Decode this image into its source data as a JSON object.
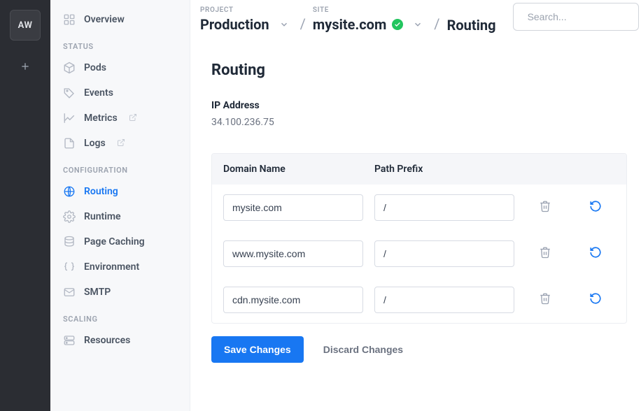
{
  "rail": {
    "workspace_initials": "AW"
  },
  "breadcrumb": {
    "project_label": "PROJECT",
    "project_value": "Production",
    "site_label": "SITE",
    "site_value": "mysite.com",
    "page_value": "Routing"
  },
  "search": {
    "placeholder": "Search..."
  },
  "sidebar": {
    "groups": [
      {
        "label": "",
        "items": [
          {
            "name": "overview",
            "label": "Overview",
            "icon": "grid-icon"
          }
        ]
      },
      {
        "label": "STATUS",
        "items": [
          {
            "name": "pods",
            "label": "Pods",
            "icon": "cube-icon"
          },
          {
            "name": "events",
            "label": "Events",
            "icon": "tag-icon"
          },
          {
            "name": "metrics",
            "label": "Metrics",
            "icon": "chart-icon",
            "external": true
          },
          {
            "name": "logs",
            "label": "Logs",
            "icon": "document-icon",
            "external": true
          }
        ]
      },
      {
        "label": "CONFIGURATION",
        "items": [
          {
            "name": "routing",
            "label": "Routing",
            "icon": "globe-icon",
            "active": true
          },
          {
            "name": "runtime",
            "label": "Runtime",
            "icon": "gear-icon"
          },
          {
            "name": "page-caching",
            "label": "Page Caching",
            "icon": "database-icon"
          },
          {
            "name": "environment",
            "label": "Environment",
            "icon": "braces-icon"
          },
          {
            "name": "smtp",
            "label": "SMTP",
            "icon": "mail-icon"
          }
        ]
      },
      {
        "label": "SCALING",
        "items": [
          {
            "name": "resources",
            "label": "Resources",
            "icon": "server-icon"
          }
        ]
      }
    ]
  },
  "page": {
    "title": "Routing",
    "ip_label": "IP Address",
    "ip_value": "34.100.236.75",
    "table": {
      "col_domain": "Domain Name",
      "col_prefix": "Path Prefix",
      "rows": [
        {
          "domain": "mysite.com",
          "prefix": "/"
        },
        {
          "domain": "www.mysite.com",
          "prefix": "/"
        },
        {
          "domain": "cdn.mysite.com",
          "prefix": "/"
        }
      ]
    },
    "save_label": "Save Changes",
    "discard_label": "Discard Changes"
  }
}
